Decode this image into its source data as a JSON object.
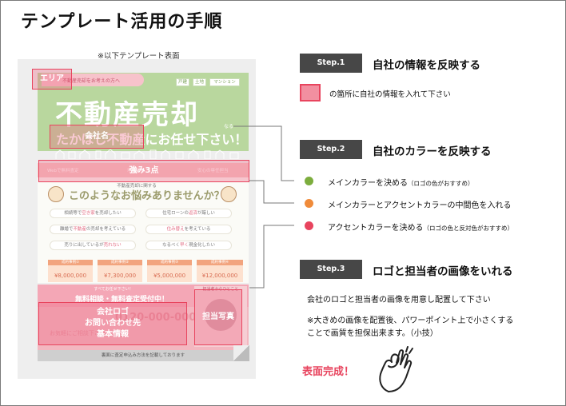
{
  "title": "テンプレート活用の手順",
  "preview_caption": "※以下テンプレート表面",
  "preview": {
    "top_tab": "不動産売却をお考えの方へ",
    "nav": [
      "戸建",
      "土地",
      "マンション"
    ],
    "headline": "不動産売却",
    "sub_headline": "たかはし不動産にお任せ下さい！",
    "suffix": "なる",
    "band_labels": [
      "Webで無料査定",
      "地域密着",
      "安心の専任担当"
    ],
    "question_small": "不動産売却に関する",
    "question": "このようなお悩みありませんか？",
    "pills": [
      {
        "pre": "相続等で",
        "hl": "空き家",
        "post": "を売却したい"
      },
      {
        "pre": "住宅ローンの",
        "hl": "返済",
        "post": "が厳しい"
      },
      {
        "pre": "離婚で",
        "hl": "不動産",
        "post": "の売却を考えている"
      },
      {
        "pre": "",
        "hl": "住み替え",
        "post": "を考えている"
      },
      {
        "pre": "売りに出しているが",
        "hl": "売れない",
        "post": ""
      },
      {
        "pre": "なるべく",
        "hl": "早く",
        "post": "現金化したい"
      }
    ],
    "prices": [
      {
        "label": "成約事例①",
        "value": "¥8,000,000"
      },
      {
        "label": "成約事例②",
        "value": "¥7,300,000"
      },
      {
        "label": "成約事例③",
        "value": "¥5,000,000"
      },
      {
        "label": "成約事例④",
        "value": "¥12,000,000"
      }
    ],
    "strip_small": "すべてお任せ下さい！",
    "free": "無料相談・無料査定受付中！",
    "phone": "0120-000-000",
    "phone_note": "お気軽にご相談下さい",
    "staff_caption": "担当者からひとこと",
    "footer": "裏面に査定申込み方法を記載しております"
  },
  "markers": {
    "area": "エリア",
    "company": "会社名",
    "strengths": "強み3点",
    "contact": [
      "会社ロゴ",
      "お問い合わせ先",
      "基本情報"
    ],
    "staff": "担当写真"
  },
  "steps": [
    {
      "badge": "Step.1",
      "title": "自社の情報を反映する"
    },
    {
      "badge": "Step.2",
      "title": "自社のカラーを反映する"
    },
    {
      "badge": "Step.3",
      "title": "ロゴと担当者の画像をいれる"
    }
  ],
  "legend_text": "の箇所に自社の情報を入れて下さい",
  "colors": {
    "main": "#7cad3d",
    "middle": "#f08b3a",
    "accent": "#e8445e",
    "badge": "#474747"
  },
  "color_items": [
    {
      "label": "メインカラーを決める",
      "note": "（ロゴの色がおすすめ）"
    },
    {
      "label": "メインカラーとアクセントカラーの中間色を入れる",
      "note": ""
    },
    {
      "label": "アクセントカラーを決める",
      "note": "（ロゴの色と反対色がおすすめ）"
    }
  ],
  "step3_lines": [
    "会社のロゴと担当者の画像を用意し配置して下さい",
    "※大きめの画像を配置後、パワーポイント上で小さくする",
    "ことで画質を担保出来ます。（小技）"
  ],
  "done": "表面完成！",
  "icons": {
    "ok_hand": "ok-hand-icon"
  }
}
